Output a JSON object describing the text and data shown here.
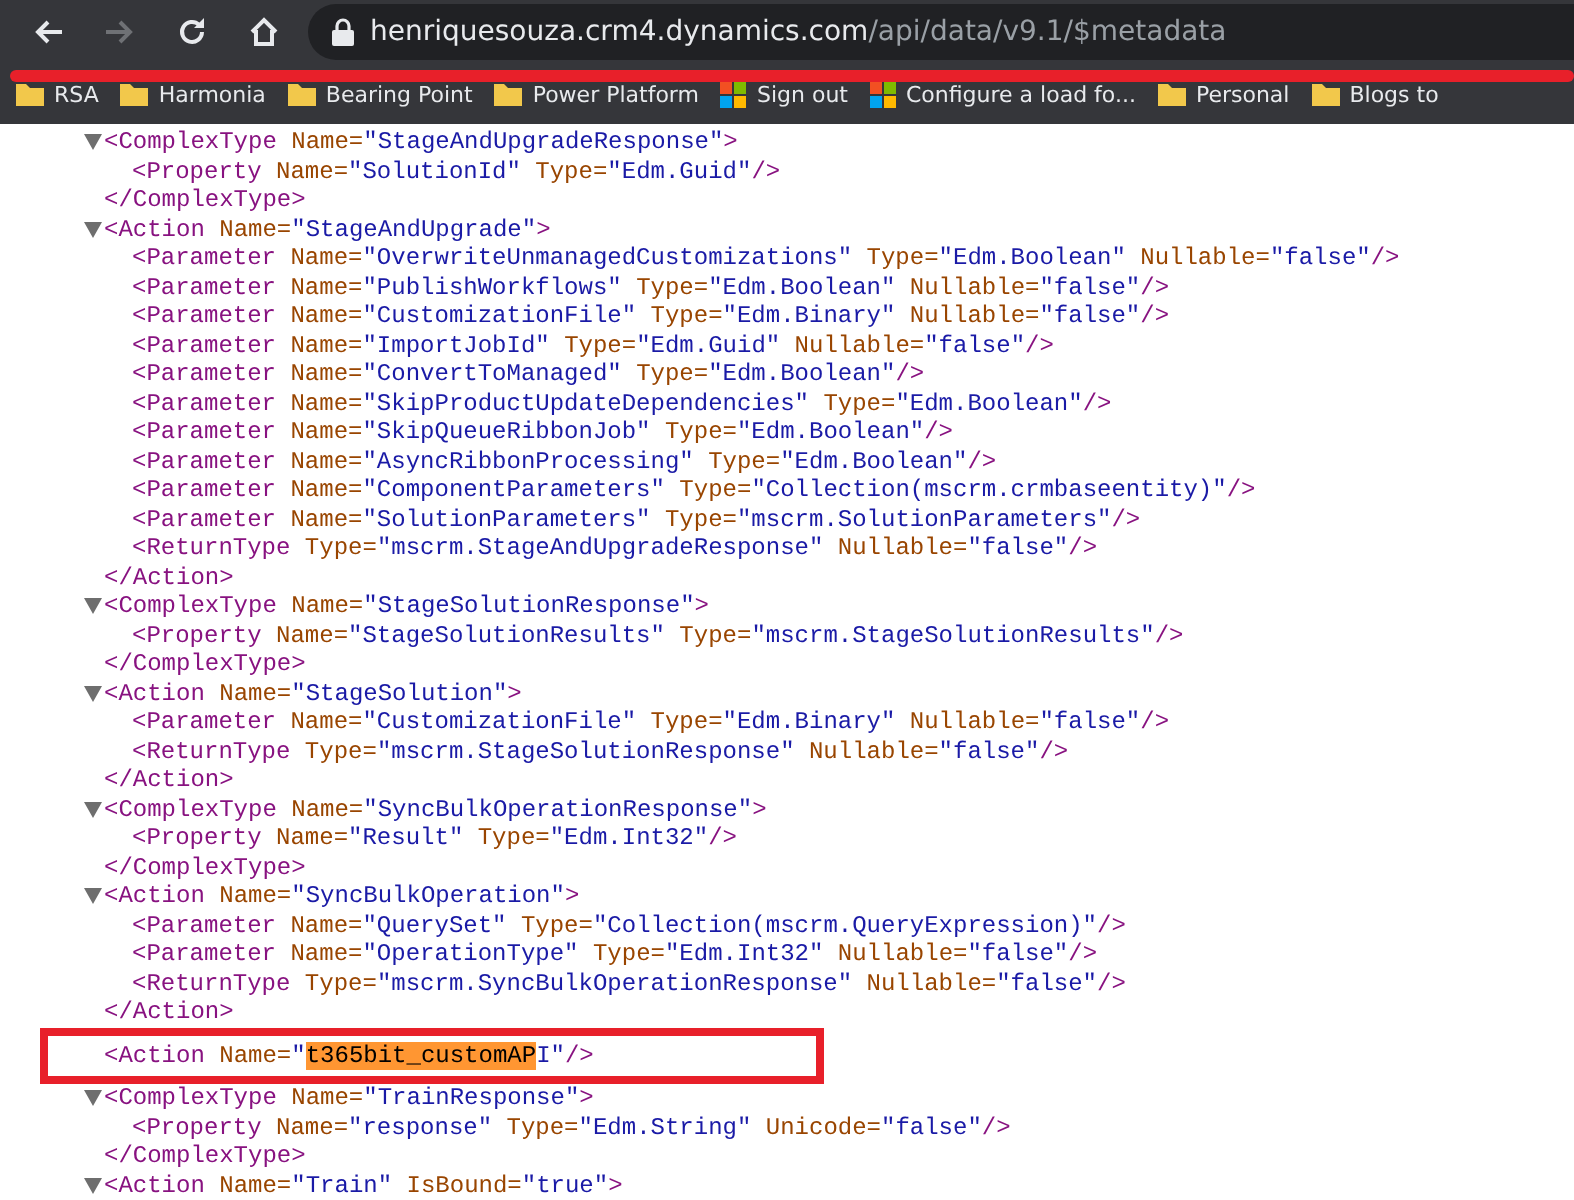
{
  "toolbar": {
    "buttons": [
      {
        "kind": "back",
        "disabled": false
      },
      {
        "kind": "forward",
        "disabled": true
      },
      {
        "kind": "reload",
        "disabled": false
      },
      {
        "kind": "home",
        "disabled": false
      }
    ],
    "address": {
      "host": "henriquesouza.crm4.dynamics.com",
      "path": "/api/data/v9.1/$metadata"
    }
  },
  "bookmarks": [
    {
      "label": "RSA",
      "kind": "folder"
    },
    {
      "label": "Harmonia",
      "kind": "folder"
    },
    {
      "label": "Bearing Point",
      "kind": "folder"
    },
    {
      "label": "Power Platform",
      "kind": "folder"
    },
    {
      "label": "Sign out",
      "kind": "microsoft"
    },
    {
      "label": "Configure a load fo...",
      "kind": "microsoft"
    },
    {
      "label": "Personal",
      "kind": "folder"
    },
    {
      "label": "Blogs to",
      "kind": "folder"
    }
  ],
  "document": {
    "nodes": [
      {
        "tag": "<ComplexType",
        "attrs": [
          {
            "name": "Name=",
            "value": "\"StageAndUpgradeResponse\""
          }
        ],
        "end": ">",
        "expanded": true,
        "children": [
          {
            "tag": "<Property",
            "attrs": [
              {
                "name": "Name=",
                "value": "\"SolutionId\""
              },
              {
                "name": "Type=",
                "value": "\"Edm.Guid\""
              }
            ],
            "end": "/>"
          }
        ],
        "close": "</ComplexType>"
      },
      {
        "tag": "<Action",
        "attrs": [
          {
            "name": "Name=",
            "value": "\"StageAndUpgrade\""
          }
        ],
        "end": ">",
        "expanded": true,
        "children": [
          {
            "tag": "<Parameter",
            "attrs": [
              {
                "name": "Name=",
                "value": "\"OverwriteUnmanagedCustomizations\""
              },
              {
                "name": "Type=",
                "value": "\"Edm.Boolean\""
              },
              {
                "name": "Nullable=",
                "value": "\"false\""
              }
            ],
            "end": "/>"
          },
          {
            "tag": "<Parameter",
            "attrs": [
              {
                "name": "Name=",
                "value": "\"PublishWorkflows\""
              },
              {
                "name": "Type=",
                "value": "\"Edm.Boolean\""
              },
              {
                "name": "Nullable=",
                "value": "\"false\""
              }
            ],
            "end": "/>"
          },
          {
            "tag": "<Parameter",
            "attrs": [
              {
                "name": "Name=",
                "value": "\"CustomizationFile\""
              },
              {
                "name": "Type=",
                "value": "\"Edm.Binary\""
              },
              {
                "name": "Nullable=",
                "value": "\"false\""
              }
            ],
            "end": "/>"
          },
          {
            "tag": "<Parameter",
            "attrs": [
              {
                "name": "Name=",
                "value": "\"ImportJobId\""
              },
              {
                "name": "Type=",
                "value": "\"Edm.Guid\""
              },
              {
                "name": "Nullable=",
                "value": "\"false\""
              }
            ],
            "end": "/>"
          },
          {
            "tag": "<Parameter",
            "attrs": [
              {
                "name": "Name=",
                "value": "\"ConvertToManaged\""
              },
              {
                "name": "Type=",
                "value": "\"Edm.Boolean\""
              }
            ],
            "end": "/>"
          },
          {
            "tag": "<Parameter",
            "attrs": [
              {
                "name": "Name=",
                "value": "\"SkipProductUpdateDependencies\""
              },
              {
                "name": "Type=",
                "value": "\"Edm.Boolean\""
              }
            ],
            "end": "/>"
          },
          {
            "tag": "<Parameter",
            "attrs": [
              {
                "name": "Name=",
                "value": "\"SkipQueueRibbonJob\""
              },
              {
                "name": "Type=",
                "value": "\"Edm.Boolean\""
              }
            ],
            "end": "/>"
          },
          {
            "tag": "<Parameter",
            "attrs": [
              {
                "name": "Name=",
                "value": "\"AsyncRibbonProcessing\""
              },
              {
                "name": "Type=",
                "value": "\"Edm.Boolean\""
              }
            ],
            "end": "/>"
          },
          {
            "tag": "<Parameter",
            "attrs": [
              {
                "name": "Name=",
                "value": "\"ComponentParameters\""
              },
              {
                "name": "Type=",
                "value": "\"Collection(mscrm.crmbaseentity)\""
              }
            ],
            "end": "/>"
          },
          {
            "tag": "<Parameter",
            "attrs": [
              {
                "name": "Name=",
                "value": "\"SolutionParameters\""
              },
              {
                "name": "Type=",
                "value": "\"mscrm.SolutionParameters\""
              }
            ],
            "end": "/>"
          },
          {
            "tag": "<ReturnType",
            "attrs": [
              {
                "name": "Type=",
                "value": "\"mscrm.StageAndUpgradeResponse\""
              },
              {
                "name": "Nullable=",
                "value": "\"false\""
              }
            ],
            "end": "/>"
          }
        ],
        "close": "</Action>"
      },
      {
        "tag": "<ComplexType",
        "attrs": [
          {
            "name": "Name=",
            "value": "\"StageSolutionResponse\""
          }
        ],
        "end": ">",
        "expanded": true,
        "children": [
          {
            "tag": "<Property",
            "attrs": [
              {
                "name": "Name=",
                "value": "\"StageSolutionResults\""
              },
              {
                "name": "Type=",
                "value": "\"mscrm.StageSolutionResults\""
              }
            ],
            "end": "/>"
          }
        ],
        "close": "</ComplexType>"
      },
      {
        "tag": "<Action",
        "attrs": [
          {
            "name": "Name=",
            "value": "\"StageSolution\""
          }
        ],
        "end": ">",
        "expanded": true,
        "children": [
          {
            "tag": "<Parameter",
            "attrs": [
              {
                "name": "Name=",
                "value": "\"CustomizationFile\""
              },
              {
                "name": "Type=",
                "value": "\"Edm.Binary\""
              },
              {
                "name": "Nullable=",
                "value": "\"false\""
              }
            ],
            "end": "/>"
          },
          {
            "tag": "<ReturnType",
            "attrs": [
              {
                "name": "Type=",
                "value": "\"mscrm.StageSolutionResponse\""
              },
              {
                "name": "Nullable=",
                "value": "\"false\""
              }
            ],
            "end": "/>"
          }
        ],
        "close": "</Action>"
      },
      {
        "tag": "<ComplexType",
        "attrs": [
          {
            "name": "Name=",
            "value": "\"SyncBulkOperationResponse\""
          }
        ],
        "end": ">",
        "expanded": true,
        "children": [
          {
            "tag": "<Property",
            "attrs": [
              {
                "name": "Name=",
                "value": "\"Result\""
              },
              {
                "name": "Type=",
                "value": "\"Edm.Int32\""
              }
            ],
            "end": "/>"
          }
        ],
        "close": "</ComplexType>"
      },
      {
        "tag": "<Action",
        "attrs": [
          {
            "name": "Name=",
            "value": "\"SyncBulkOperation\""
          }
        ],
        "end": ">",
        "expanded": true,
        "children": [
          {
            "tag": "<Parameter",
            "attrs": [
              {
                "name": "Name=",
                "value": "\"QuerySet\""
              },
              {
                "name": "Type=",
                "value": "\"Collection(mscrm.QueryExpression)\""
              }
            ],
            "end": "/>"
          },
          {
            "tag": "<Parameter",
            "attrs": [
              {
                "name": "Name=",
                "value": "\"OperationType\""
              },
              {
                "name": "Type=",
                "value": "\"Edm.Int32\""
              },
              {
                "name": "Nullable=",
                "value": "\"false\""
              }
            ],
            "end": "/>"
          },
          {
            "tag": "<ReturnType",
            "attrs": [
              {
                "name": "Type=",
                "value": "\"mscrm.SyncBulkOperationResponse\""
              },
              {
                "name": "Nullable=",
                "value": "\"false\""
              }
            ],
            "end": "/>"
          }
        ],
        "close": "</Action>"
      },
      {
        "tag": "<Action",
        "attrs": [
          {
            "name": "Name=",
            "parts": [
              {
                "text": "\"",
                "highlighted": false
              },
              {
                "text": "t365bit_customAP",
                "highlighted": true
              },
              {
                "text": "I\"",
                "highlighted": false
              }
            ]
          }
        ],
        "end": "/>",
        "annotated": true
      },
      {
        "tag": "<ComplexType",
        "attrs": [
          {
            "name": "Name=",
            "value": "\"TrainResponse\""
          }
        ],
        "end": ">",
        "expanded": true,
        "children": [
          {
            "tag": "<Property",
            "attrs": [
              {
                "name": "Name=",
                "value": "\"response\""
              },
              {
                "name": "Type=",
                "value": "\"Edm.String\""
              },
              {
                "name": "Unicode=",
                "value": "\"false\""
              }
            ],
            "end": "/>"
          }
        ],
        "close": "</ComplexType>"
      },
      {
        "tag": "<Action",
        "attrs": [
          {
            "name": "Name=",
            "value": "\"Train\""
          },
          {
            "name": "IsBound=",
            "value": "\"true\""
          }
        ],
        "end": ">",
        "expanded": true
      }
    ]
  }
}
